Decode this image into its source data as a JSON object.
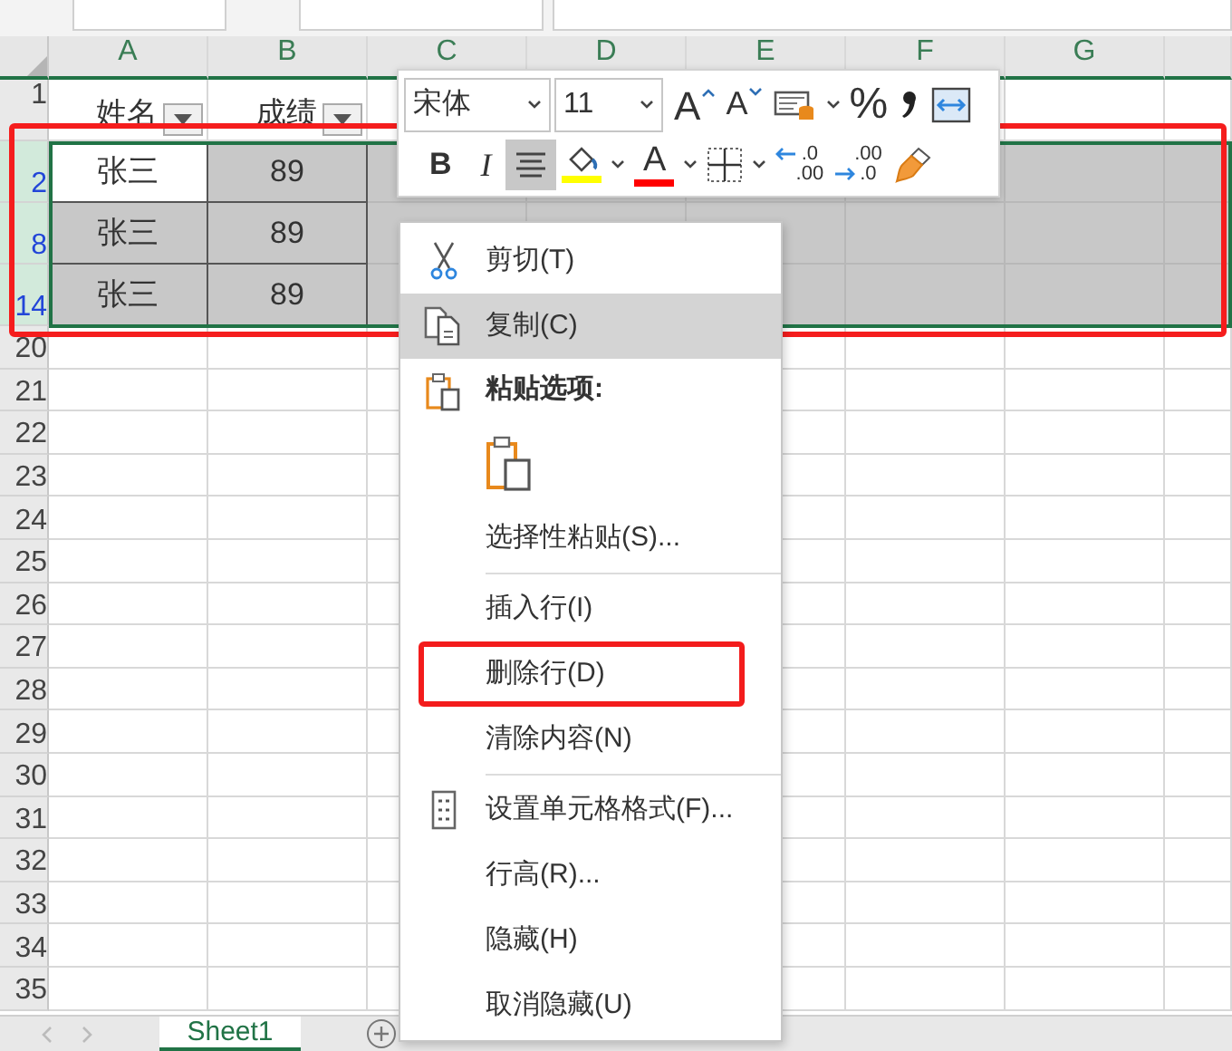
{
  "columns": [
    {
      "label": "A"
    },
    {
      "label": "B"
    },
    {
      "label": "C"
    },
    {
      "label": "D"
    },
    {
      "label": "E"
    },
    {
      "label": "F"
    },
    {
      "label": "G"
    }
  ],
  "rows": [
    {
      "number": "1",
      "selected": false,
      "cells": [
        {
          "text": "姓名",
          "filter": true
        },
        {
          "text": "成绩",
          "filter": true
        }
      ]
    },
    {
      "number": "2",
      "selected": true,
      "cells": [
        {
          "text": "张三",
          "active": true
        },
        {
          "text": "89",
          "active": false
        }
      ]
    },
    {
      "number": "8",
      "selected": true,
      "cells": [
        {
          "text": "张三",
          "active": false
        },
        {
          "text": "89",
          "active": false
        }
      ]
    },
    {
      "number": "14",
      "selected": true,
      "cells": [
        {
          "text": "张三",
          "active": false
        },
        {
          "text": "89",
          "active": false
        }
      ]
    },
    {
      "number": "20",
      "selected": false
    },
    {
      "number": "21",
      "selected": false
    },
    {
      "number": "22",
      "selected": false
    },
    {
      "number": "23",
      "selected": false
    },
    {
      "number": "24",
      "selected": false
    },
    {
      "number": "25",
      "selected": false
    },
    {
      "number": "26",
      "selected": false
    },
    {
      "number": "27",
      "selected": false
    },
    {
      "number": "28",
      "selected": false
    },
    {
      "number": "29",
      "selected": false
    },
    {
      "number": "30",
      "selected": false
    },
    {
      "number": "31",
      "selected": false
    },
    {
      "number": "32",
      "selected": false
    },
    {
      "number": "33",
      "selected": false
    },
    {
      "number": "34",
      "selected": false
    },
    {
      "number": "35",
      "selected": false
    }
  ],
  "selection": {
    "outlined": true
  },
  "mini_toolbar": {
    "font": "宋体",
    "size": "11",
    "rows": [
      [
        {
          "kind": "grow_font",
          "label": "A",
          "selected": false,
          "dropdown": false
        },
        {
          "kind": "shrink_font",
          "label": "A",
          "selected": false,
          "dropdown": false
        },
        {
          "kind": "cell_styles",
          "selected": false,
          "dropdown": true
        },
        {
          "kind": "percent",
          "label": "%",
          "selected": false,
          "dropdown": false
        },
        {
          "kind": "comma",
          "selected": false,
          "dropdown": false
        },
        {
          "kind": "wrap",
          "selected": false,
          "dropdown": false
        }
      ],
      [
        {
          "kind": "bold",
          "label": "B",
          "selected": false,
          "dropdown": false
        },
        {
          "kind": "italic",
          "label": "I",
          "selected": false,
          "dropdown": false
        },
        {
          "kind": "align_center",
          "selected": true,
          "dropdown": false
        },
        {
          "kind": "fill_color",
          "color": "#ffff00",
          "selected": false,
          "dropdown": true
        },
        {
          "kind": "font_color",
          "label": "A",
          "color": "#ff0000",
          "selected": false,
          "dropdown": true
        },
        {
          "kind": "borders",
          "selected": false,
          "dropdown": true
        },
        {
          "kind": "increase_decimal",
          "top": ".0",
          "bottom": ".00",
          "selected": false,
          "dropdown": false
        },
        {
          "kind": "decrease_decimal",
          "top": ".00",
          "bottom": ".0",
          "selected": false,
          "dropdown": false
        },
        {
          "kind": "format_painter",
          "selected": false,
          "dropdown": false
        }
      ]
    ]
  },
  "context_menu": {
    "items": [
      {
        "kind": "cut",
        "label": "剪切(T)",
        "selected": false
      },
      {
        "kind": "copy",
        "label": "复制(C)",
        "selected": true
      },
      {
        "kind": "paste_header",
        "label": "粘贴选项:"
      },
      {
        "kind": "paste_option"
      },
      {
        "kind": "item",
        "label": "选择性粘贴(S)...",
        "selected": false
      },
      {
        "kind": "separator"
      },
      {
        "kind": "item",
        "label": "插入行(I)",
        "selected": false
      },
      {
        "kind": "item",
        "label": "删除行(D)",
        "selected": false,
        "outlined": true
      },
      {
        "kind": "item",
        "label": "清除内容(N)",
        "selected": false
      },
      {
        "kind": "separator"
      },
      {
        "kind": "format_cells",
        "label": "设置单元格格式(F)...",
        "selected": false
      },
      {
        "kind": "item",
        "label": "行高(R)...",
        "selected": false
      },
      {
        "kind": "item",
        "label": "隐藏(H)",
        "selected": false
      },
      {
        "kind": "item",
        "label": "取消隐藏(U)",
        "selected": false
      }
    ]
  },
  "sheet_tabs": [
    {
      "label": "Sheet1",
      "selected": true
    }
  ]
}
